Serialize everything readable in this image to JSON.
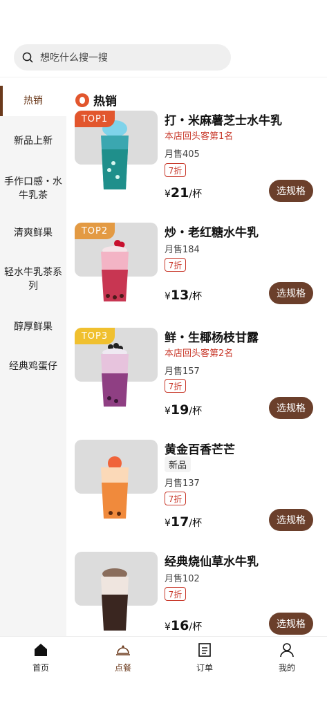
{
  "search": {
    "placeholder": "想吃什么搜一搜"
  },
  "sidebar": {
    "items": [
      {
        "label": "热销"
      },
      {
        "label": "新品上新"
      },
      {
        "label": "手作口感・水牛乳茶"
      },
      {
        "label": "清爽鲜果"
      },
      {
        "label": "轻水牛乳茶系列"
      },
      {
        "label": "醇厚鲜果"
      },
      {
        "label": "经典鸡蛋仔"
      }
    ]
  },
  "section": {
    "title": "热销"
  },
  "products": [
    {
      "rank": "TOP1",
      "name": "打・米麻薯芝士水牛乳",
      "repeat": "本店回头客第1名",
      "sales": "月售405",
      "discount": "7折",
      "currency": "¥",
      "price": "21",
      "unit": "/杯",
      "button": "选规格"
    },
    {
      "rank": "TOP2",
      "name": "炒・老红糖水牛乳",
      "sales": "月售184",
      "discount": "7折",
      "currency": "¥",
      "price": "13",
      "unit": "/杯",
      "button": "选规格"
    },
    {
      "rank": "TOP3",
      "name": "鲜・生椰杨枝甘露",
      "repeat": "本店回头客第2名",
      "sales": "月售157",
      "discount": "7折",
      "currency": "¥",
      "price": "19",
      "unit": "/杯",
      "button": "选规格"
    },
    {
      "name": "黄金百香芒芒",
      "tag": "新品",
      "sales": "月售137",
      "discount": "7折",
      "currency": "¥",
      "price": "17",
      "unit": "/杯",
      "button": "选规格"
    },
    {
      "name": "经典烧仙草水牛乳",
      "sales": "月售102",
      "discount": "7折",
      "currency": "¥",
      "price": "16",
      "unit": "/杯",
      "button": "选规格"
    }
  ],
  "tabs": [
    {
      "label": "首页",
      "icon": "home-icon"
    },
    {
      "label": "点餐",
      "icon": "cloche-icon"
    },
    {
      "label": "订单",
      "icon": "order-icon"
    },
    {
      "label": "我的",
      "icon": "user-icon"
    }
  ],
  "colors": {
    "accent": "#6b3a1c",
    "button": "#6b3f2b",
    "discount": "#c8382a",
    "top1": "#e2562d",
    "top2": "#e39a43",
    "top3": "#f0c02f"
  }
}
